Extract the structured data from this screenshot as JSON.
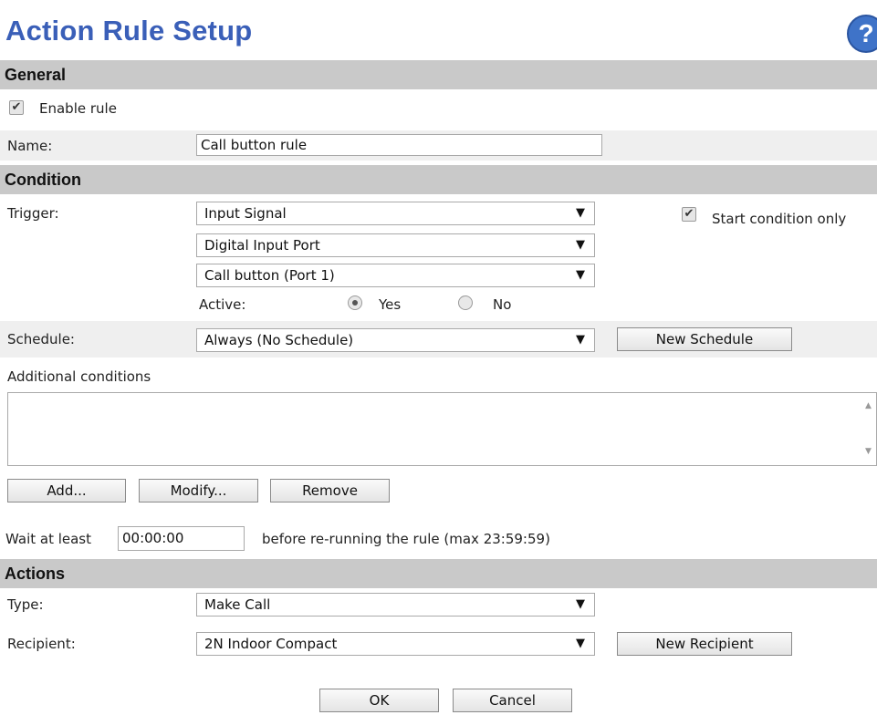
{
  "header": {
    "title": "Action Rule Setup",
    "help_glyph": "?"
  },
  "general": {
    "section_label": "General",
    "enable_rule": {
      "label": "Enable rule",
      "checked": true
    },
    "name_label": "Name:",
    "name_value": "Call button rule"
  },
  "condition": {
    "section_label": "Condition",
    "trigger_label": "Trigger:",
    "trigger_select": "Input Signal",
    "source_select": "Digital Input Port",
    "port_select": "Call button (Port 1)",
    "start_condition_only": {
      "label": "Start condition only",
      "checked": true
    },
    "active_label": "Active:",
    "active_yes": "Yes",
    "active_no": "No",
    "active_selected": "Yes",
    "schedule_label": "Schedule:",
    "schedule_select": "Always (No Schedule)",
    "new_schedule_button": "New Schedule",
    "additional_conditions_label": "Additional conditions",
    "add_button": "Add...",
    "modify_button": "Modify...",
    "remove_button": "Remove",
    "wait_prefix": "Wait at least",
    "wait_value": "00:00:00",
    "wait_suffix": "before re-running the rule (max 23:59:59)"
  },
  "actions": {
    "section_label": "Actions",
    "type_label": "Type:",
    "type_select": "Make Call",
    "recipient_label": "Recipient:",
    "recipient_select": "2N Indoor Compact",
    "new_recipient_button": "New Recipient"
  },
  "footer": {
    "ok_button": "OK",
    "cancel_button": "Cancel"
  },
  "icons": {
    "dropdown_arrow": "▼",
    "check": "✔"
  },
  "colors": {
    "title": "#3a5fb8",
    "section_bg": "#c9c9c9",
    "row_bg": "#efefef",
    "help_bg": "#3f73c8"
  }
}
